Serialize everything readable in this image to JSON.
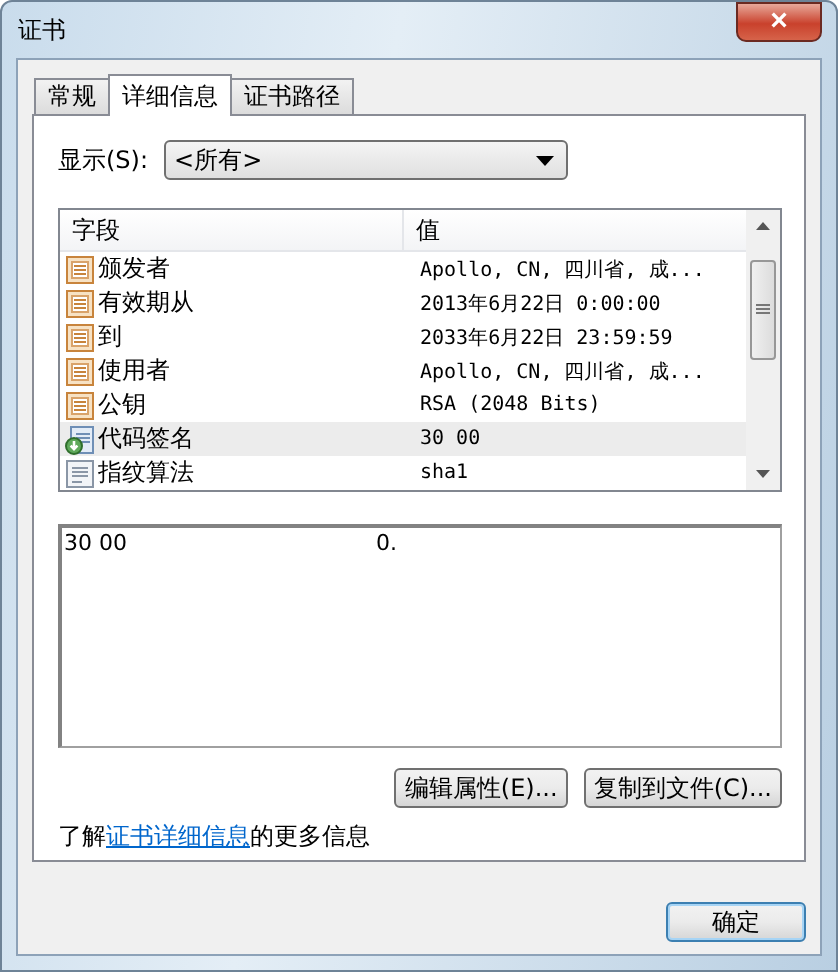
{
  "window": {
    "title": "证书",
    "close": "×"
  },
  "tabs": [
    {
      "label": "常规",
      "selected": false
    },
    {
      "label": "详细信息",
      "selected": true
    },
    {
      "label": "证书路径",
      "selected": false
    }
  ],
  "show": {
    "label": "显示(S):",
    "value": "<所有>"
  },
  "table": {
    "columns": [
      "字段",
      "值"
    ],
    "rows": [
      {
        "field": "颁发者",
        "value": "Apollo, CN, 四川省, 成...",
        "kind": "cert",
        "selected": false
      },
      {
        "field": "有效期从",
        "value": "2013年6月22日 0:00:00",
        "kind": "cert",
        "selected": false
      },
      {
        "field": "到",
        "value": "2033年6月22日 23:59:59",
        "kind": "cert",
        "selected": false
      },
      {
        "field": "使用者",
        "value": "Apollo, CN, 四川省, 成...",
        "kind": "cert",
        "selected": false
      },
      {
        "field": "公钥",
        "value": "RSA (2048 Bits)",
        "kind": "cert",
        "selected": false
      },
      {
        "field": "代码签名",
        "value": "30 00",
        "kind": "extension",
        "selected": true
      },
      {
        "field": "指纹算法",
        "value": "sha1",
        "kind": "property",
        "selected": false
      }
    ]
  },
  "detail": {
    "hex": "30 00",
    "ascii": "0."
  },
  "buttons": [
    "编辑属性(E)...",
    "复制到文件(C)..."
  ],
  "info": {
    "before": "了解",
    "link": "证书详细信息",
    "after": "的更多信息"
  },
  "ok": "确定"
}
